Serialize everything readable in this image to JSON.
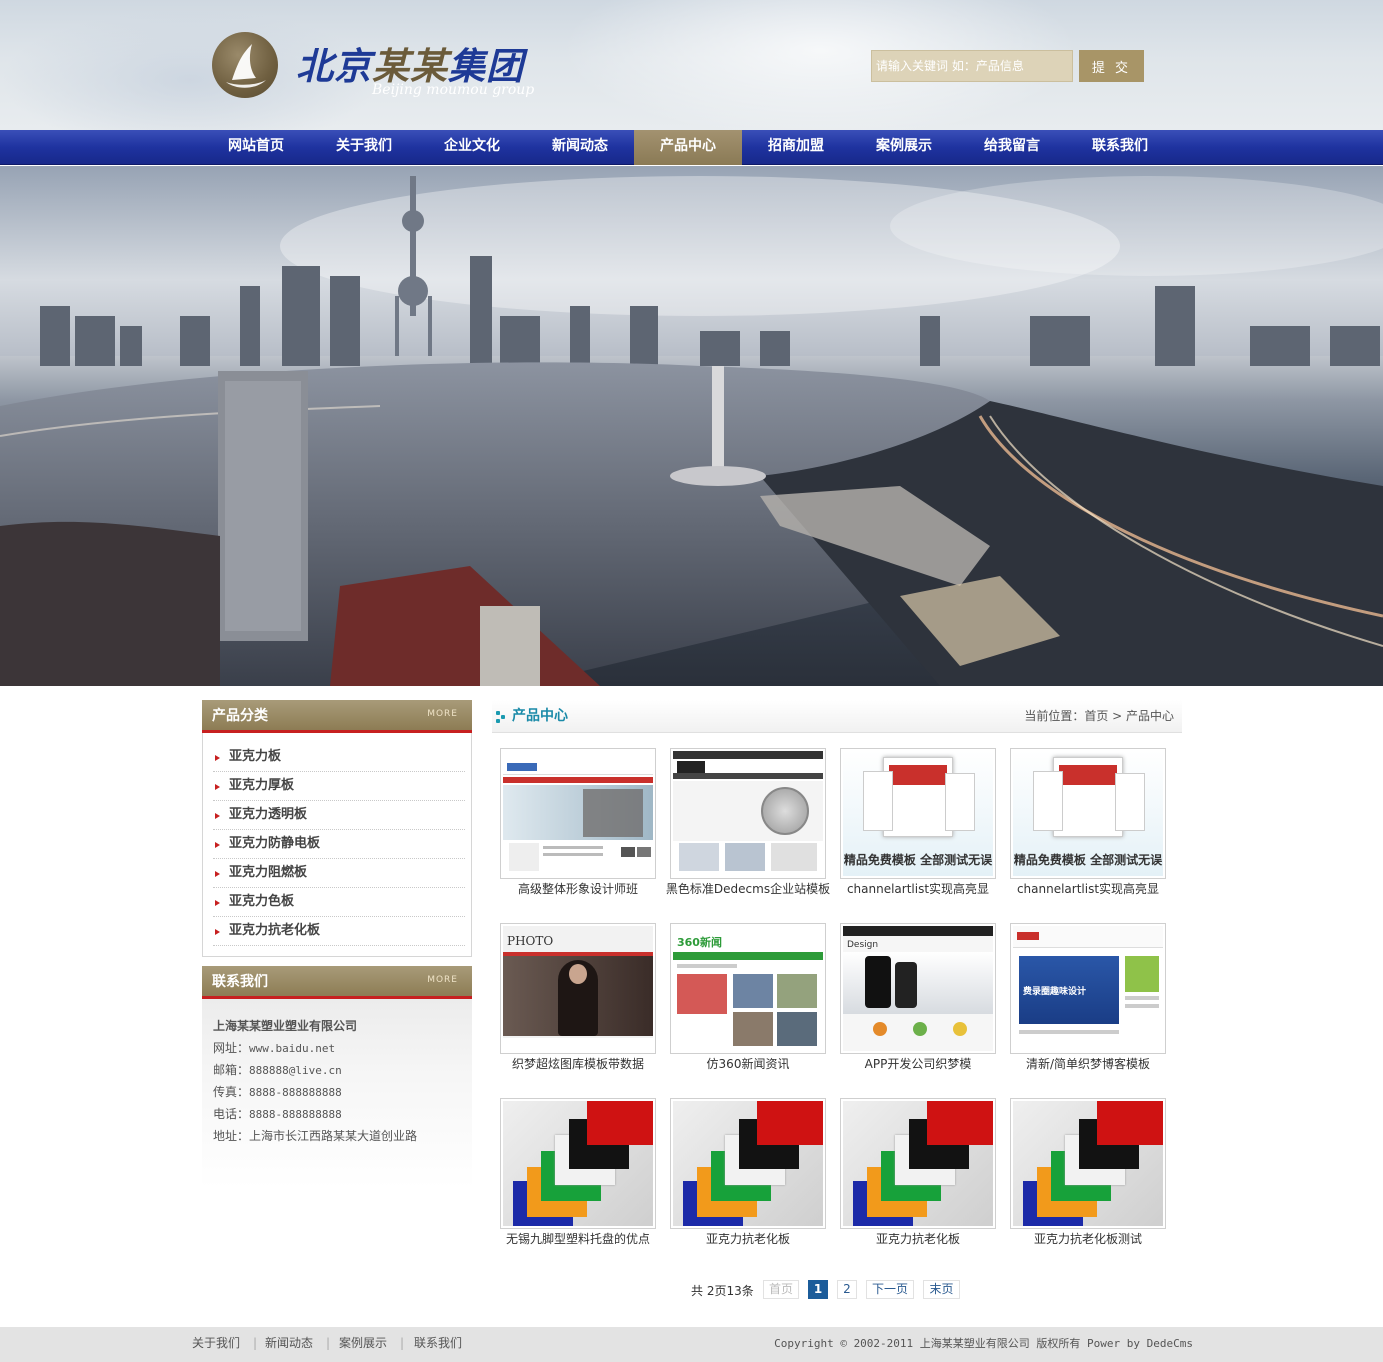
{
  "brand": {
    "cn_part1": "北京",
    "cn_part2": "某某",
    "cn_part3": "集团",
    "en": "Beijing moumou group"
  },
  "search": {
    "placeholder": "请输入关键词 如：产品信息",
    "button_label": "提 交"
  },
  "nav": {
    "items": [
      "网站首页",
      "关于我们",
      "企业文化",
      "新闻动态",
      "产品中心",
      "招商加盟",
      "案例展示",
      "给我留言",
      "联系我们"
    ],
    "active_index": 4
  },
  "banner": {
    "slide_count": 3,
    "active_slide": 1
  },
  "sidebar": {
    "categories_title": "产品分类",
    "more_label": "MORE",
    "categories": [
      "亚克力板",
      "亚克力厚板",
      "亚克力透明板",
      "亚克力防静电板",
      "亚克力阻燃板",
      "亚克力色板",
      "亚克力抗老化板"
    ],
    "contact_title": "联系我们",
    "company": "上海某某塑业塑业有限公司",
    "contact_lines": [
      {
        "label": "网址：",
        "value": "www.baidu.net"
      },
      {
        "label": "邮箱：",
        "value": "888888@live.cn"
      },
      {
        "label": "传真：",
        "value": "8888-888888888"
      },
      {
        "label": "电话：",
        "value": "8888-888888888"
      },
      {
        "label": "地址：",
        "value": "上海市长江西路某某大道创业路"
      }
    ]
  },
  "main": {
    "title": "产品中心",
    "breadcrumb": "当前位置：首页 > 产品中心",
    "products": [
      {
        "caption": "高级整体形象设计师班",
        "thumb": "site-red"
      },
      {
        "caption": "黑色标准Dedecms企业站模板",
        "thumb": "site-globe"
      },
      {
        "caption": "channelartlist实现高亮显",
        "thumb": "template-devices"
      },
      {
        "caption": "channelartlist实现高亮显",
        "thumb": "template-devices"
      },
      {
        "caption": "织梦超炫图库模板带数据",
        "thumb": "site-photo"
      },
      {
        "caption": "仿360新闻资讯",
        "thumb": "site-360"
      },
      {
        "caption": "APP开发公司织梦模",
        "thumb": "site-app"
      },
      {
        "caption": "清新/简单织梦博客模板",
        "thumb": "site-blog"
      },
      {
        "caption": "无锡九脚型塑料托盘的优点",
        "thumb": "acrylic-sheets"
      },
      {
        "caption": "亚克力抗老化板",
        "thumb": "acrylic-sheets"
      },
      {
        "caption": "亚克力抗老化板",
        "thumb": "acrylic-sheets"
      },
      {
        "caption": "亚克力抗老化板测试",
        "thumb": "acrylic-sheets"
      }
    ],
    "thumb_texts": {
      "template_banner": "精品免费模板 全部测试无误",
      "photo_logo": "PHOTO",
      "news_logo": "360新闻",
      "design_logo": "Design",
      "blog_banner": "费录圈趣味设计"
    }
  },
  "pagination": {
    "summary": "共 2页13条",
    "first": "首页",
    "pages": [
      "1",
      "2"
    ],
    "current": "1",
    "next": "下一页",
    "last": "末页"
  },
  "footer": {
    "links": [
      "关于我们",
      "新闻动态",
      "案例展示",
      "联系我们"
    ],
    "copyright": "Copyright © 2002-2011 上海某某塑业有限公司 版权所有 Power by DedeCms"
  },
  "colors": {
    "nav_blue": "#1f33a0",
    "gold": "#8d7c54",
    "accent_red": "#c72020",
    "teal": "#1a8aa8"
  }
}
